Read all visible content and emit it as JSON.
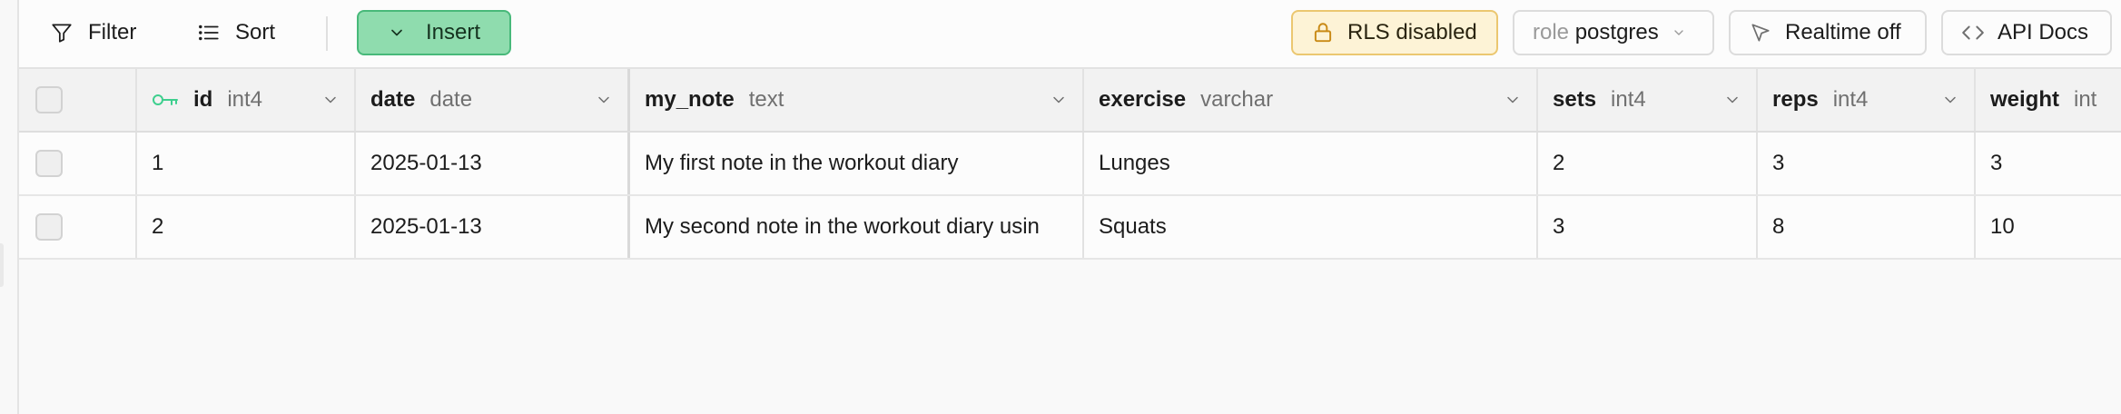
{
  "toolbar": {
    "filter_label": "Filter",
    "sort_label": "Sort",
    "insert_label": "Insert",
    "rls_label": "RLS disabled",
    "role_prefix": "role",
    "role_value": "postgres",
    "realtime_label": "Realtime off",
    "api_docs_label": "API Docs"
  },
  "icons": {
    "filter": "filter-icon",
    "sort": "sort-icon",
    "insert_chevron": "chevron-down-icon",
    "rls": "lock-icon",
    "role_chevron": "chevron-down-icon",
    "realtime": "cursor-icon",
    "api_docs": "code-icon",
    "primary_key": "key-icon"
  },
  "colors": {
    "insert_bg": "#8fdcae",
    "insert_border": "#48b97a",
    "rls_bg": "#fdf3d6",
    "rls_border": "#ebc770",
    "key_icon": "#3ecf8e"
  },
  "table": {
    "columns": [
      {
        "name": "id",
        "type": "int4",
        "primary_key": true
      },
      {
        "name": "date",
        "type": "date"
      },
      {
        "name": "my_note",
        "type": "text"
      },
      {
        "name": "exercise",
        "type": "varchar"
      },
      {
        "name": "sets",
        "type": "int4"
      },
      {
        "name": "reps",
        "type": "int4"
      },
      {
        "name": "weight",
        "type": "int"
      }
    ],
    "rows": [
      {
        "id": "1",
        "date": "2025-01-13",
        "my_note": "My first note in the workout diary",
        "exercise": "Lunges",
        "sets": "2",
        "reps": "3",
        "weight": "3"
      },
      {
        "id": "2",
        "date": "2025-01-13",
        "my_note": "My second note in the workout diary usin",
        "exercise": "Squats",
        "sets": "3",
        "reps": "8",
        "weight": "10"
      }
    ]
  }
}
